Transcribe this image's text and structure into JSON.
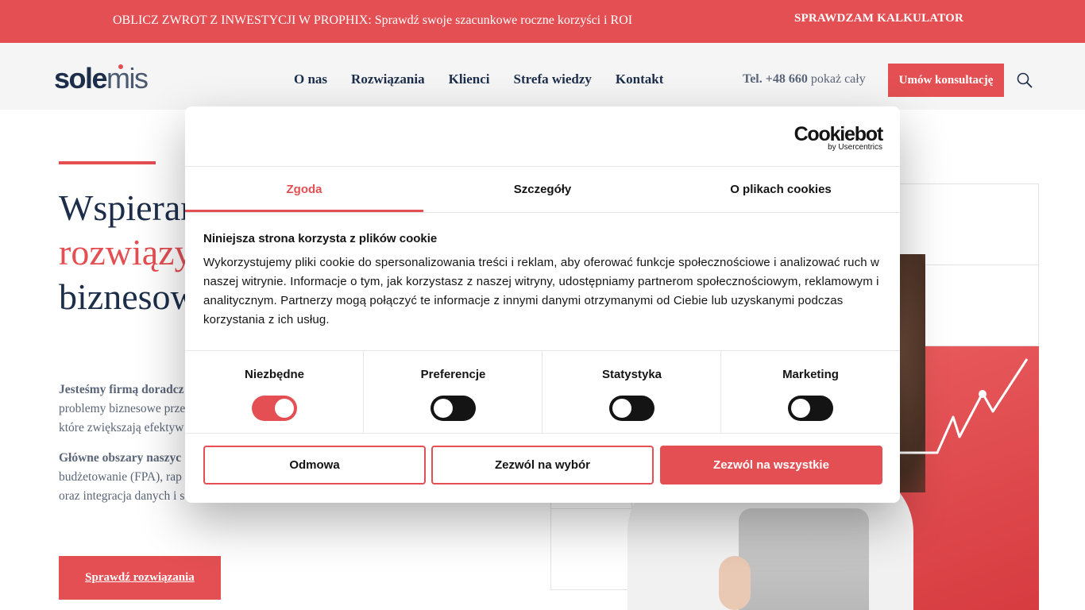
{
  "promo": {
    "text": "OBLICZ ZWROT Z INWESTYCJI W PROPHIX: Sprawdź swoje szacunkowe roczne korzyści i ROI",
    "cta": "SPRAWDZAM KALKULATOR"
  },
  "header": {
    "logo_part1": "sole",
    "logo_part2": "mis",
    "nav": [
      "O nas",
      "Rozwiązania",
      "Klienci",
      "Strefa wiedzy",
      "Kontakt"
    ],
    "phone_label": "Tel. +48 660",
    "phone_more": "pokaż cały",
    "consult_button": "Umów konsultację",
    "search_icon": "search-icon"
  },
  "hero": {
    "title_line1": "Wspieramy",
    "title_line2": "rozwiązy",
    "title_line3": "biznesow",
    "para1_bold": "Jesteśmy firmą doradcz",
    "para1_line2": "problemy biznesowe prze",
    "para1_line3": "które zwiększają efektyw",
    "para2_bold": "Główne obszary naszyc",
    "para2_line2": "budżetowanie (FPA), rap",
    "para2_line3": "oraz integracja danych i s",
    "cta_button": "Sprawdź rozwiązania"
  },
  "cookie": {
    "brand": "Cookiebot",
    "brand_sub": "by Usercentrics",
    "tabs": [
      "Zgoda",
      "Szczegóły",
      "O plikach cookies"
    ],
    "active_tab": 0,
    "heading": "Niniejsza strona korzysta z plików cookie",
    "body": "Wykorzystujemy pliki cookie do spersonalizowania treści i reklam, aby oferować funkcje społecznościowe i analizować ruch w naszej witrynie. Informacje o tym, jak korzystasz z naszej witryny, udostępniamy partnerom społecznościowym, reklamowym i analitycznym. Partnerzy mogą połączyć te informacje z innymi danymi otrzymanymi od Ciebie lub uzyskanymi podczas korzystania z ich usług.",
    "categories": [
      {
        "label": "Niezbędne",
        "enabled": true
      },
      {
        "label": "Preferencje",
        "enabled": false
      },
      {
        "label": "Statystyka",
        "enabled": false
      },
      {
        "label": "Marketing",
        "enabled": false
      }
    ],
    "buttons": {
      "deny": "Odmowa",
      "allow_selection": "Zezwól na wybór",
      "allow_all": "Zezwól na wszystkie"
    }
  },
  "colors": {
    "accent": "#e34f53",
    "navy": "#1c2e4a",
    "text_muted": "#5a6578"
  }
}
